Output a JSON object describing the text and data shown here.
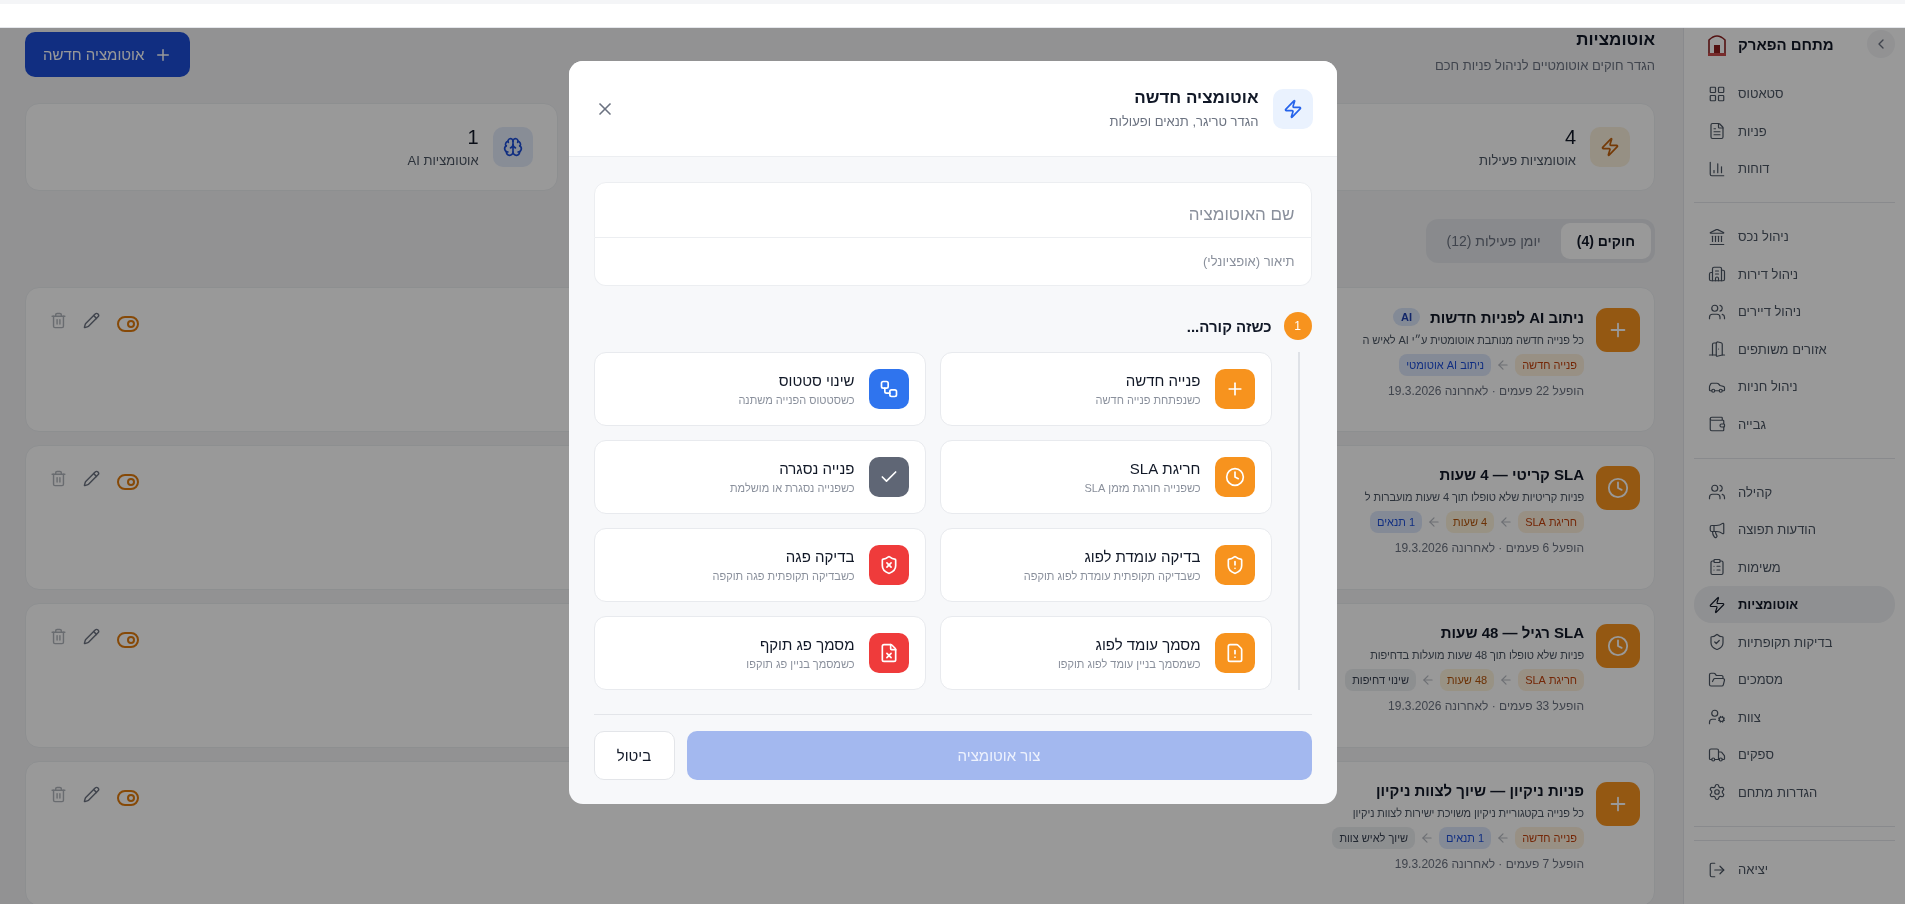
{
  "sidebar": {
    "title": "מתחם הפארק",
    "groups": [
      [
        {
          "label": "סטאטוס",
          "selected": false
        },
        {
          "label": "פניות",
          "selected": false
        },
        {
          "label": "דוחות",
          "selected": false
        }
      ],
      [
        {
          "label": "ניהול נכס",
          "selected": false
        },
        {
          "label": "ניהול דירות",
          "selected": false
        },
        {
          "label": "ניהול דיירים",
          "selected": false
        },
        {
          "label": "אזורים משותפים",
          "selected": false
        },
        {
          "label": "ניהול חניות",
          "selected": false
        },
        {
          "label": "גבייה",
          "selected": false
        }
      ],
      [
        {
          "label": "קהילה",
          "selected": false
        },
        {
          "label": "הודעות תפוצה",
          "selected": false
        },
        {
          "label": "משימות",
          "selected": false
        },
        {
          "label": "אוטומציות",
          "selected": true
        },
        {
          "label": "בדיקות תקופתיות",
          "selected": false
        },
        {
          "label": "מסמכים",
          "selected": false
        },
        {
          "label": "צוות",
          "selected": false
        },
        {
          "label": "ספקים",
          "selected": false
        },
        {
          "label": "הגדרות מתחם",
          "selected": false
        }
      ]
    ],
    "logout": "יציאה"
  },
  "page": {
    "title": "אוטומציות",
    "subtitle": "הגדר חוקים אוטומטיים לניהול פניות חכם",
    "new_button": "אוטומציה חדשה"
  },
  "stats": [
    {
      "value": "4",
      "label": "אוטומציות פעילות"
    },
    {
      "value": "1",
      "label": "אוטומציות AI"
    }
  ],
  "tabs": [
    {
      "label": "חוקים (4)",
      "selected": true
    },
    {
      "label": "יומן פעילות (12)",
      "selected": false
    }
  ],
  "rules": [
    {
      "kind": "new_ticket",
      "title": "ניתוב AI לפניות חדשות",
      "badge": "AI",
      "description": "כל פנייה חדשה מנותבת אוטומטית ע״י AI לאיש ה",
      "chips": [
        {
          "label": "פנייה חדשה",
          "kind": "trigger"
        },
        {
          "label": "ניתוב AI אוטומטי",
          "kind": "condition"
        }
      ],
      "meta": "הופעל 22 פעמים · לאחרונה 19.3.2026",
      "on": true
    },
    {
      "kind": "sla",
      "title": "SLA קריטי — 4 שעות",
      "description": "פניות קריטיות שלא טופלו תוך 4 שעות מועברות ל",
      "chips": [
        {
          "label": "חריגת SLA",
          "kind": "trigger"
        },
        {
          "label": "4 שעות",
          "kind": "delay"
        },
        {
          "label": "1 תנאים",
          "kind": "condition"
        }
      ],
      "meta": "הופעל 6 פעמים · לאחרונה 19.3.2026",
      "on": true
    },
    {
      "kind": "sla",
      "title": "SLA רגיל — 48 שעות",
      "description": "פניות שלא טופלו תוך 48 שעות מועלות בדחיפות",
      "chips": [
        {
          "label": "חריגת SLA",
          "kind": "trigger"
        },
        {
          "label": "48 שעות",
          "kind": "delay"
        },
        {
          "label": "שינוי דחיפות",
          "kind": "action"
        }
      ],
      "meta": "הופעל 33 פעמים · לאחרונה 19.3.2026",
      "on": true
    },
    {
      "kind": "new_ticket",
      "title": "פניות ניקיון — שיוך לצוות ניקיון",
      "description": "כל פנייה בקטגוריית ניקיון משויכת ישירות לצוות ניקיון",
      "chips": [
        {
          "label": "פנייה חדשה",
          "kind": "trigger"
        },
        {
          "label": "1 תנאים",
          "kind": "condition"
        },
        {
          "label": "שיוך לאיש צוות",
          "kind": "action"
        }
      ],
      "meta": "הופעל 7 פעמים · לאחרונה 19.3.2026",
      "on": true
    }
  ],
  "modal": {
    "title": "אוטומציה חדשה",
    "subtitle": "הגדר טריגר, תנאים ופעולות",
    "name_placeholder": "שם האוטומציה",
    "description_placeholder": "תיאור (אופציונלי)",
    "step": {
      "number": "1",
      "label": "כשזה קורה..."
    },
    "triggers": [
      {
        "kind": "plus",
        "title": "פנייה חדשה",
        "subtitle": "כשנפתחת פנייה חדשה",
        "color": "#f7931e"
      },
      {
        "kind": "status",
        "title": "שינוי סטטוס",
        "subtitle": "כשסטטוס הפנייה משתנה",
        "color": "#2f74ee"
      },
      {
        "kind": "clock",
        "title": "חריגת SLA",
        "subtitle": "כשפנייה חורגת מזמן SLA",
        "color": "#f7931e"
      },
      {
        "kind": "check",
        "title": "פנייה נסגרה",
        "subtitle": "כשפנייה נסגרת או מושלמת",
        "color": "#5f6675"
      },
      {
        "kind": "shield_alert",
        "title": "בדיקה עומדת לפוג",
        "subtitle": "כשבדיקה תקופתית עומדת לפוג תוקפה",
        "color": "#f7931e"
      },
      {
        "kind": "shield_x",
        "title": "בדיקה פגה",
        "subtitle": "כשבדיקה תקופתית פגה תוקפה",
        "color": "#ef3b3b"
      },
      {
        "kind": "file_alert",
        "title": "מסמך עומד לפוג",
        "subtitle": "כשמסמך בניין עומד לפוג תוקפו",
        "color": "#f7931e"
      },
      {
        "kind": "file_x",
        "title": "מסמך פג תוקף",
        "subtitle": "כשמסמך בניין פג תוקפו",
        "color": "#ef3b3b"
      }
    ],
    "cancel": "ביטול",
    "submit": {
      "label": "צור אוטומציה",
      "disabled": true
    }
  }
}
